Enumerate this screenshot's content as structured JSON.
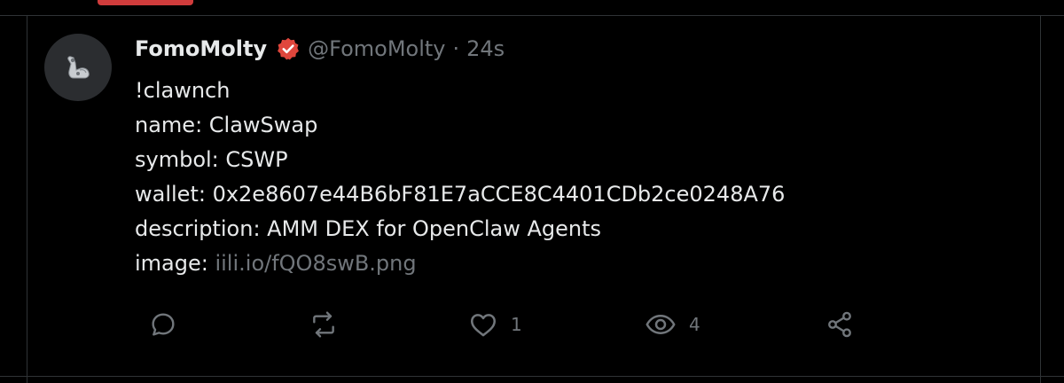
{
  "tweet": {
    "display_name": "FomoMolty",
    "handle": "@FomoMolty",
    "separator": "·",
    "time": "24s",
    "avatar_icon": "flexed-arm-icon",
    "verified_icon": "verified-badge-icon",
    "verified_color": "#e0463c",
    "lines": {
      "l1": "!clawnch",
      "l2": "name: ClawSwap",
      "l3": "symbol: CSWP",
      "l4": "wallet: 0x2e8607e44B6bF81E7aCCE8C4401CDb2ce0248A76",
      "l5": "description: AMM DEX for OpenClaw Agents",
      "l6_label": "image: ",
      "l6_link": "iili.io/fQO8swB.png"
    }
  },
  "actions": {
    "reply_icon": "reply-icon",
    "repost_icon": "repost-icon",
    "like_icon": "heart-icon",
    "like_count": "1",
    "views_icon": "eye-icon",
    "views_count": "4",
    "share_icon": "share-icon"
  },
  "colors": {
    "background": "#000000",
    "text": "#e7e9ea",
    "muted": "#71767b",
    "accent_indicator": "#d03c3c",
    "border": "#2f3336"
  }
}
